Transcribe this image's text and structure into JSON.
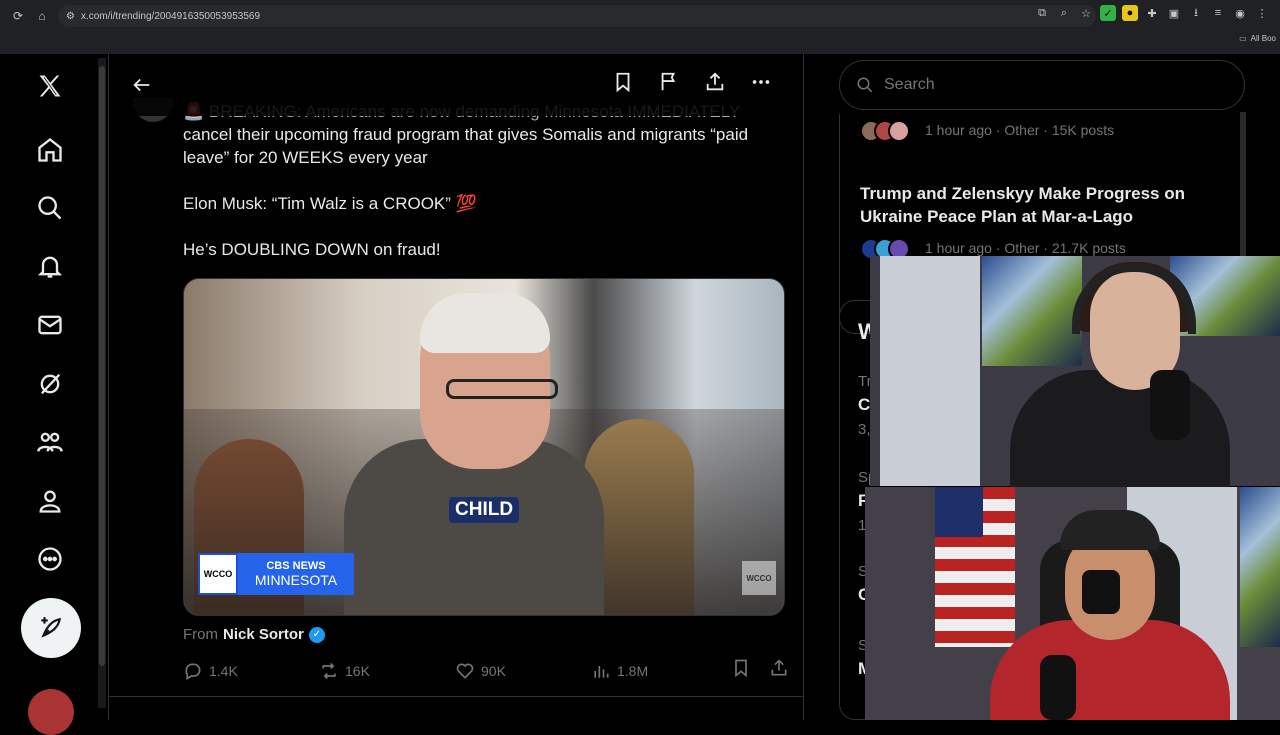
{
  "browser": {
    "url": "x.com/i/trending/2004916350053953569",
    "bookmarks_label": "All Boo"
  },
  "nav": {
    "items": [
      "x-logo",
      "home",
      "explore",
      "notifications",
      "messages",
      "grok",
      "communities",
      "profile",
      "more"
    ],
    "post_button_icon": "feather-plus-icon"
  },
  "post": {
    "header_actions": [
      "bookmark",
      "flag",
      "share",
      "more"
    ],
    "text_line1": "🚨 BREAKING: Americans are now demanding Minnesota IMMEDIATELY",
    "text_line2": "cancel their upcoming fraud program that gives Somalis and migrants “paid leave” for 20 WEEKS every year",
    "text_para2": "Elon Musk: “Tim Walz is a CROOK”",
    "text_para2_emoji": "💯",
    "text_para3": "He’s DOUBLING DOWN on fraud!",
    "media": {
      "caption": "CHILD",
      "badge_left": "WCCO",
      "badge_network": "CBS NEWS",
      "badge_region": "MINNESOTA",
      "watermark": "WCCO"
    },
    "from_label": "From",
    "from_name": "Nick Sortor",
    "stats": {
      "replies": "1.4K",
      "reposts": "16K",
      "likes": "90K",
      "views": "1.8M"
    }
  },
  "right": {
    "search_placeholder": "Search",
    "trend1_meta": "1 hour ago · Other · 15K posts",
    "trend2_title": "Trump and Zelenskyy Make Progress on Ukraine Peace Plan at Mar-a-Lago",
    "trend2_meta": "1 hour ago · Other · 21.7K posts",
    "who_letter": "W",
    "fragments": [
      "Tr",
      "C",
      "3,",
      "Sp",
      "F",
      "1",
      "S",
      "C",
      "S",
      "M"
    ]
  },
  "colors": {
    "accent": "#1d9bf0",
    "background": "#000000",
    "text": "#e7e9ea",
    "muted": "#71767b",
    "border": "#2f3336"
  }
}
